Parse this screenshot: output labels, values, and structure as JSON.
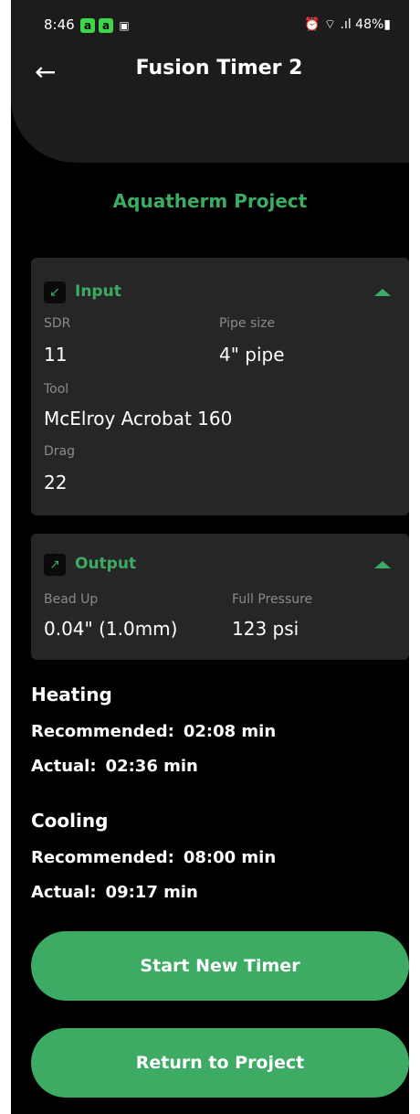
{
  "status": {
    "time": "8:46",
    "notif1": "a",
    "notif2": "a",
    "notif3": "▣",
    "right": "⏰ ⌔ .ıl 48%▮"
  },
  "header": {
    "back_icon": "←",
    "title": "Fusion Timer 2"
  },
  "project": {
    "name": "Aquatherm Project"
  },
  "input_card": {
    "icon": "↙",
    "title": "Input",
    "sdr_label": "SDR",
    "sdr_value": "11",
    "pipe_label": "Pipe size",
    "pipe_value": "4\" pipe",
    "tool_label": "Tool",
    "tool_value": "McElroy Acrobat 160",
    "drag_label": "Drag",
    "drag_value": "22"
  },
  "output_card": {
    "icon": "↗",
    "title": "Output",
    "bead_label": "Bead Up",
    "bead_value": "0.04\" (1.0mm)",
    "pressure_label": "Full Pressure",
    "pressure_value": "123 psi"
  },
  "heating": {
    "title": "Heating",
    "recommended_label": "Recommended:",
    "recommended_value": "02:08 min",
    "actual_label": "Actual:",
    "actual_value": "02:36 min"
  },
  "cooling": {
    "title": "Cooling",
    "recommended_label": "Recommended:",
    "recommended_value": "08:00 min",
    "actual_label": "Actual:",
    "actual_value": "09:17 min"
  },
  "buttons": {
    "start_new": "Start New Timer",
    "return_project": "Return to Project"
  },
  "colors": {
    "accent": "#3cab64",
    "card_bg": "#262626",
    "background": "#000000"
  }
}
